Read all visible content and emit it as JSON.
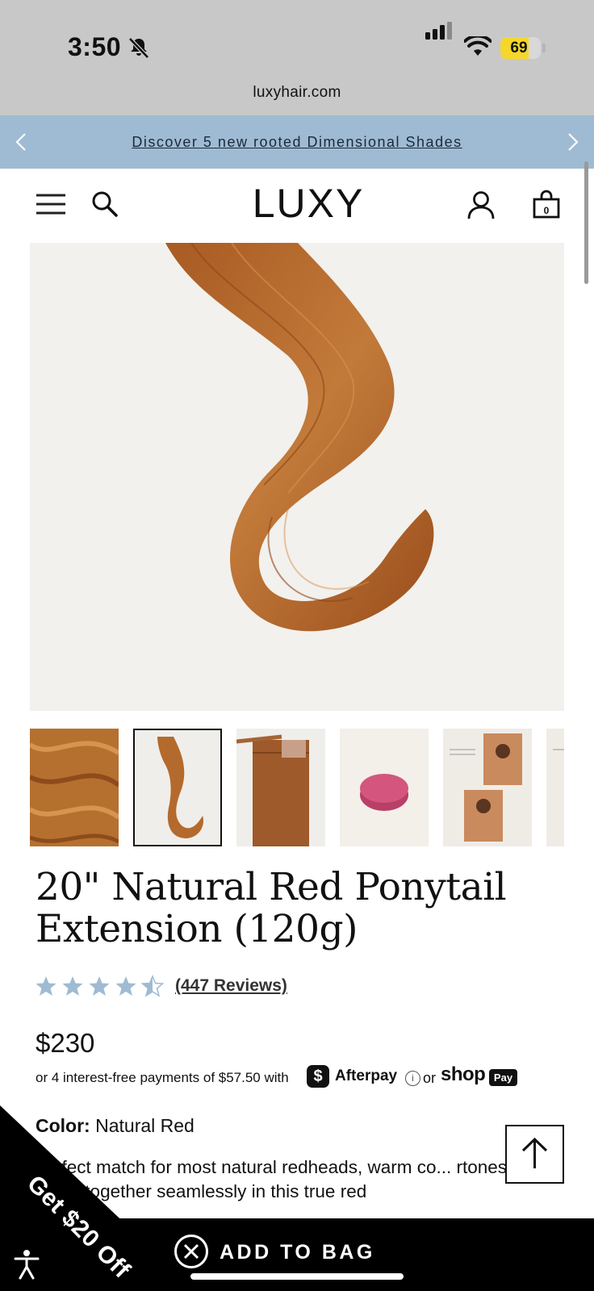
{
  "status_bar": {
    "time": "3:50",
    "battery_percent": "69",
    "battery_level": 0.69
  },
  "browser": {
    "url": "luxyhair.com"
  },
  "announcement": {
    "text": "Discover 5 new rooted Dimensional Shades"
  },
  "header": {
    "logo": "LUXY",
    "cart_count": "0"
  },
  "product": {
    "title": "20\" Natural Red Ponytail Extension (120g)",
    "rating": 4.5,
    "reviews_label": "(447 Reviews)",
    "price": "$230",
    "installments_text": "or 4 interest-free payments of $57.50 with",
    "afterpay_label": "Afterpay",
    "or_label": "or",
    "shop_label": "shop",
    "pay_label": "Pay",
    "color_label": "Color:",
    "color_value": "Natural Red",
    "description": "perfect match for most natural redheads, warm co... rtones blend together seamlessly in this true red"
  },
  "thumbnails": [
    {
      "name": "thumbnail-hair-closeup",
      "selected": false
    },
    {
      "name": "thumbnail-ponytail",
      "selected": true
    },
    {
      "name": "thumbnail-ponytail-wrap",
      "selected": false
    },
    {
      "name": "thumbnail-case",
      "selected": false
    },
    {
      "name": "thumbnail-guide",
      "selected": false
    },
    {
      "name": "thumbnail-guide-2",
      "selected": false
    }
  ],
  "bottom_bar": {
    "add_to_bag_label": "ADD TO BAG",
    "promo_label": "Get $20 Off"
  },
  "colors": {
    "announcement_bg": "#9fbbd3",
    "hair": "#b46a2c",
    "star": "#9fbbd3",
    "bottom_bar": "#000000"
  },
  "icons": [
    "bell-slash-icon",
    "signal-icon",
    "wifi-icon",
    "battery-icon",
    "chevron-left-icon",
    "chevron-right-icon",
    "menu-icon",
    "search-icon",
    "account-icon",
    "bag-icon",
    "star-icon",
    "info-icon",
    "arrow-up-icon",
    "close-icon",
    "accessibility-icon"
  ]
}
